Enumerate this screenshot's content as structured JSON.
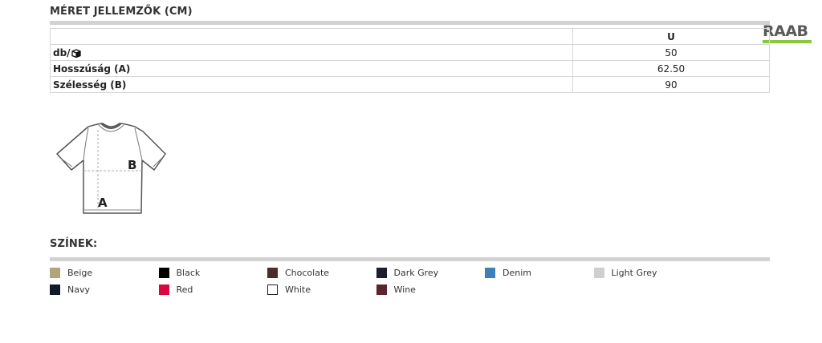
{
  "size_section": {
    "title": "MÉRET JELLEMZŐK (CM)",
    "table": {
      "header": [
        "",
        "U"
      ],
      "rows": [
        {
          "label": "db/",
          "icon": "box-icon",
          "value": "50"
        },
        {
          "label": "Hosszúság (A)",
          "value": "62.50"
        },
        {
          "label": "Szélesség (B)",
          "value": "90"
        }
      ]
    }
  },
  "logo": {
    "text": "RAAB",
    "accent_color": "#8cc63f"
  },
  "diagram": {
    "label_a": "A",
    "label_b": "B"
  },
  "colors_section": {
    "title": "SZÍNEK:",
    "colors": [
      {
        "name": "Beige",
        "hex": "#b0a47a"
      },
      {
        "name": "Black",
        "hex": "#000000"
      },
      {
        "name": "Chocolate",
        "hex": "#4a2e2e"
      },
      {
        "name": "Dark Grey",
        "hex": "#1a1f2b"
      },
      {
        "name": "Denim",
        "hex": "#3d7fb8"
      },
      {
        "name": "Light Grey",
        "hex": "#cfcfcf"
      },
      {
        "name": "Navy",
        "hex": "#0f1b26"
      },
      {
        "name": "Red",
        "hex": "#d9063f"
      },
      {
        "name": "White",
        "hex": "#ffffff"
      },
      {
        "name": "Wine",
        "hex": "#5a2430"
      }
    ]
  }
}
